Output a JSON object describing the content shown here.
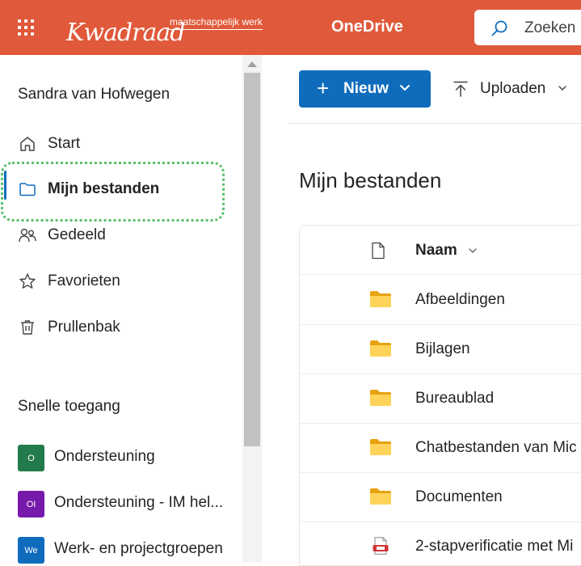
{
  "header": {
    "logo_main": "Kwadraad",
    "logo_sub": "maatschappelijk werk",
    "app_name": "OneDrive",
    "search_placeholder": "Zoeken",
    "brand_color": "#e0593a"
  },
  "sidebar": {
    "user_name": "Sandra van Hofwegen",
    "nav": [
      {
        "label": "Start",
        "icon": "home-icon"
      },
      {
        "label": "Mijn bestanden",
        "icon": "folder-icon",
        "active": true
      },
      {
        "label": "Gedeeld",
        "icon": "people-icon"
      },
      {
        "label": "Favorieten",
        "icon": "star-icon"
      },
      {
        "label": "Prullenbak",
        "icon": "trash-icon"
      }
    ],
    "quick_access_title": "Snelle toegang",
    "quick_access": [
      {
        "badge": "O",
        "label": "Ondersteuning",
        "color": "#237b4b"
      },
      {
        "badge": "OI",
        "label": "Ondersteuning - IM hel...",
        "color": "#7719aa"
      },
      {
        "badge": "We",
        "label": "Werk- en projectgroepen",
        "color": "#0f6cbd"
      }
    ]
  },
  "toolbar": {
    "new_label": "Nieuw",
    "upload_label": "Uploaden",
    "accent": "#0f6cbd"
  },
  "main": {
    "title": "Mijn bestanden",
    "column_name": "Naam",
    "files": [
      {
        "name": "Afbeeldingen",
        "type": "folder"
      },
      {
        "name": "Bijlagen",
        "type": "folder"
      },
      {
        "name": "Bureaublad",
        "type": "folder"
      },
      {
        "name": "Chatbestanden van Mic",
        "type": "folder"
      },
      {
        "name": "Documenten",
        "type": "folder"
      },
      {
        "name": "2-stapverificatie met Mi",
        "type": "pdf"
      }
    ]
  }
}
